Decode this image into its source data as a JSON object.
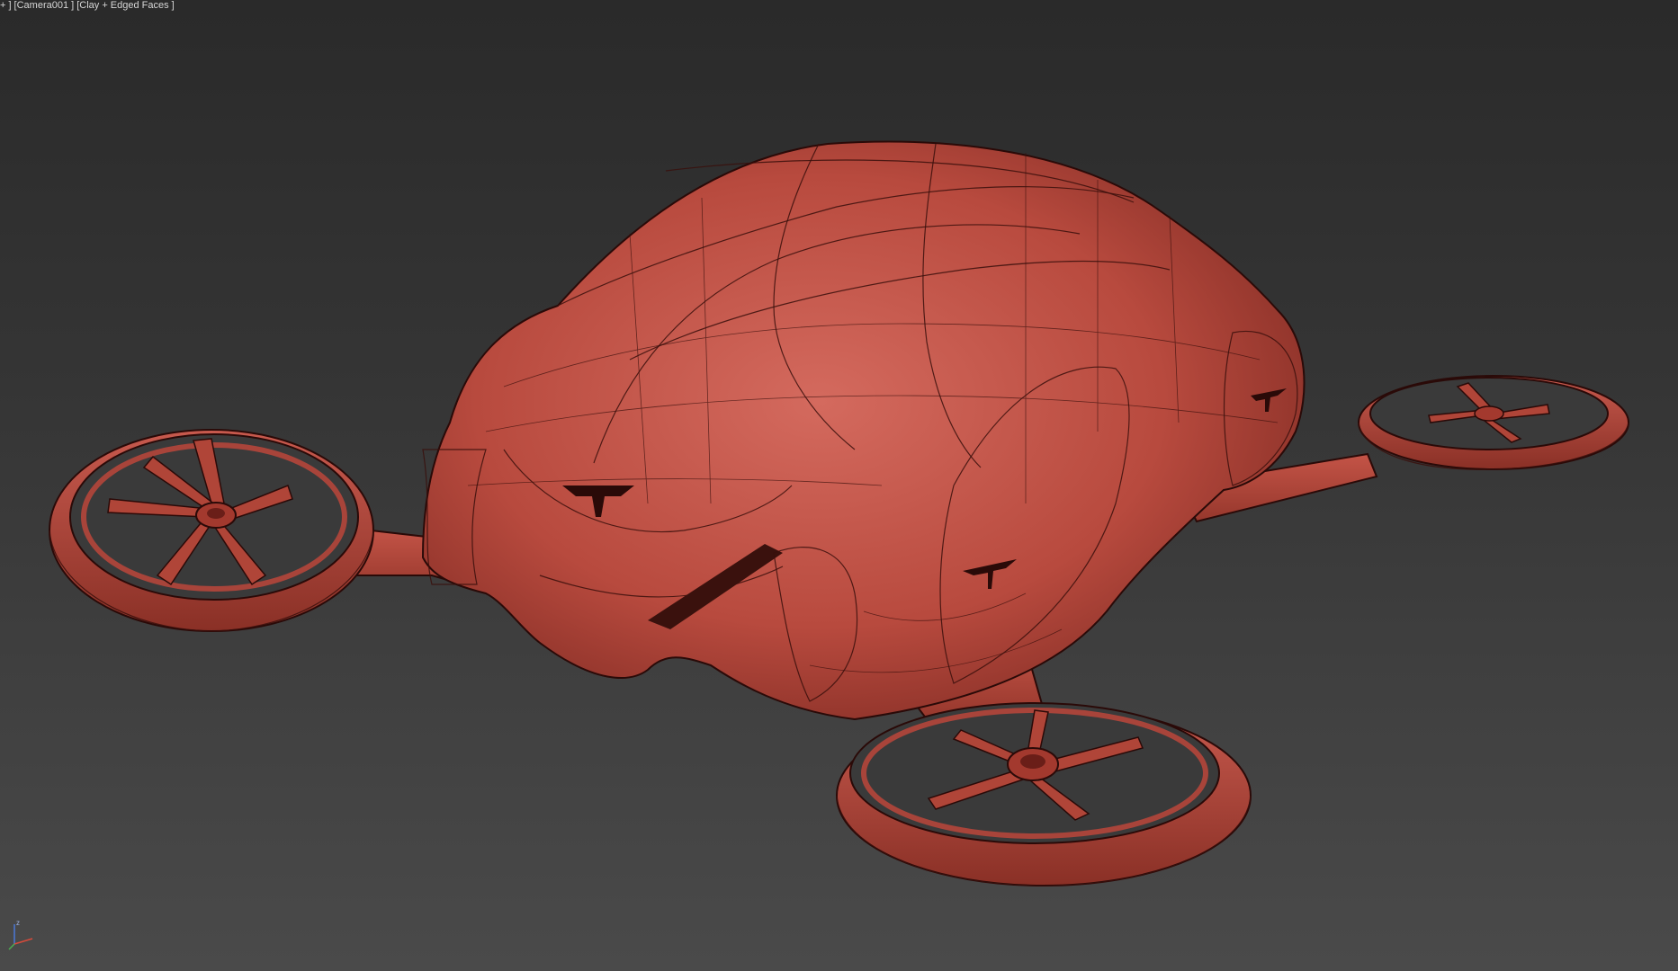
{
  "viewport": {
    "label_prefix": "+ ]",
    "camera_label": "[Camera001 ]",
    "shading_label": "[Clay + Edged Faces ]"
  },
  "colors": {
    "background_top": "#2a2a2a",
    "background_bottom": "#4a4a4a",
    "clay": "#b84a3e",
    "clay_light": "#d0645a",
    "clay_dark": "#7e2a22",
    "wire": "#3a0f0c"
  },
  "gizmo": {
    "icon": "axis-tripod-icon",
    "z_label": "z",
    "x_color": "#d94a3a",
    "y_color": "#4caf50",
    "z_color": "#4a78d9"
  }
}
